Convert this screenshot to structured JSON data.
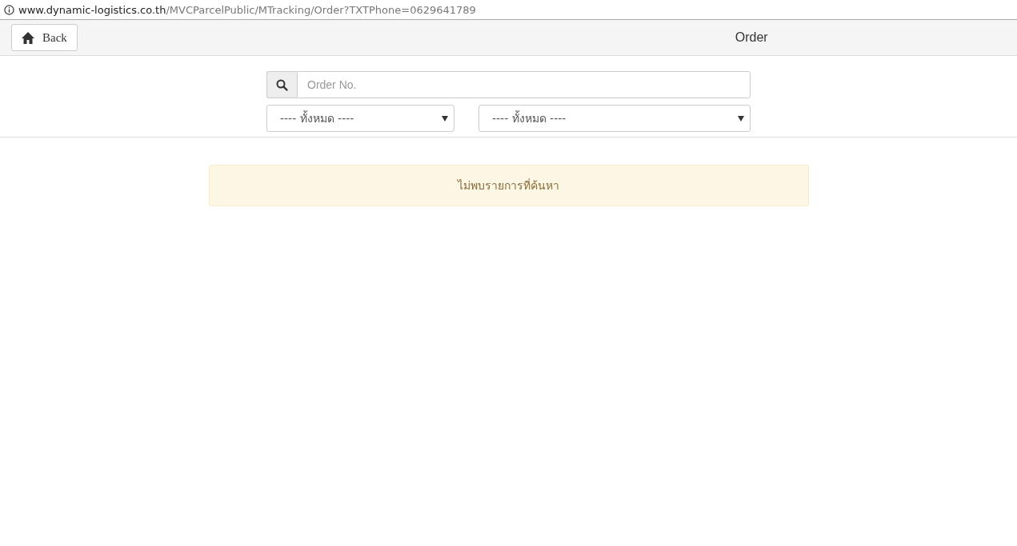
{
  "address_bar": {
    "host": "www.dynamic-logistics.co.th",
    "path": "/MVCParcelPublic/MTracking/Order?TXTPhone=0629641789"
  },
  "header": {
    "back_button": "Back",
    "title": "Order"
  },
  "search": {
    "placeholder": "Order No."
  },
  "filters": [
    {
      "value": "---- ทั้งหมด ----"
    },
    {
      "value": "---- ทั้งหมด ----"
    }
  ],
  "alert": {
    "message": "ไม่พบรายการที่ค้นหา"
  }
}
